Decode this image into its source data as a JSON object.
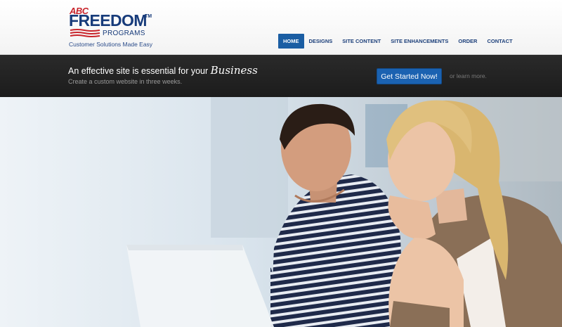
{
  "logo": {
    "abc": "ABC",
    "freedom": "FREEDOM",
    "tm": "TM",
    "programs": "PROGRAMS",
    "tagline": "Customer Solutions Made Easy"
  },
  "nav": {
    "items": [
      {
        "label": "HOME",
        "active": true
      },
      {
        "label": "DESIGNS",
        "active": false
      },
      {
        "label": "SITE CONTENT",
        "active": false
      },
      {
        "label": "SITE ENHANCEMENTS",
        "active": false
      },
      {
        "label": "ORDER",
        "active": false
      },
      {
        "label": "CONTACT",
        "active": false
      }
    ]
  },
  "banner": {
    "headline": "An effective site is essential for your",
    "headline_script": "Business",
    "subtext": "Create a custom website in three weeks.",
    "cta_label": "Get Started Now!",
    "learn_more": "or learn more."
  },
  "colors": {
    "brand_blue": "#173b7a",
    "brand_red": "#c8242b",
    "nav_active": "#1b5ea3",
    "banner_bg": "#222222",
    "cta": "#1b62b1"
  }
}
